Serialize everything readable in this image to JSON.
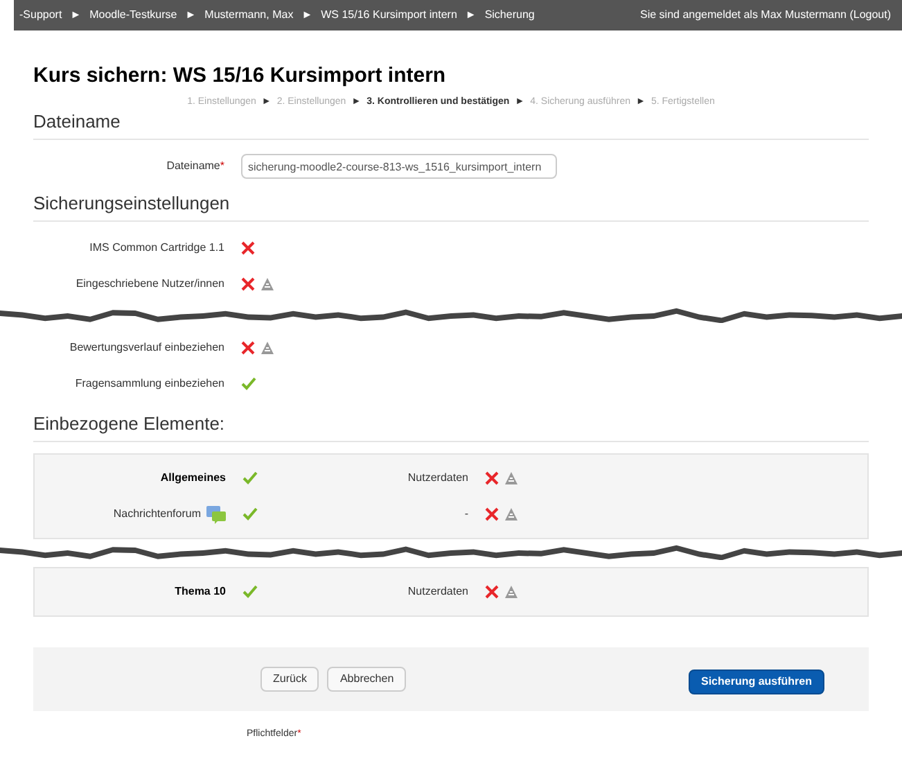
{
  "navbar": {
    "breadcrumbs": [
      "-Support",
      "Moodle-Testkurse",
      "Mustermann, Max",
      "WS 15/16 Kursimport intern",
      "Sicherung"
    ],
    "separator": "►",
    "login": "Sie sind angemeldet als Max Mustermann (Logout)"
  },
  "title": "Kurs sichern: WS 15/16 Kursimport intern",
  "steps": [
    {
      "label": "1. Einstellungen",
      "selected": false
    },
    {
      "label": "2. Einstellungen",
      "selected": false
    },
    {
      "label": "3. Kontrollieren und bestätigen",
      "selected": true
    },
    {
      "label": "4. Sicherung ausführen",
      "selected": false
    },
    {
      "label": "5. Fertigstellen",
      "selected": false
    }
  ],
  "filename_section": {
    "heading": "Dateiname",
    "label": "Dateiname",
    "required_mark": "*",
    "value": "sicherung-moodle2-course-813-ws_1516_kursimport_intern"
  },
  "settings_section": {
    "heading": "Sicherungseinstellungen",
    "items": [
      {
        "label": "IMS Common Cartridge 1.1",
        "included": false,
        "locked": false,
        "cut_below": false
      },
      {
        "label": "Eingeschriebene Nutzer/innen",
        "included": false,
        "locked": true,
        "cut_below": true
      },
      {
        "label": "Bewertungsverlauf einbeziehen",
        "included": false,
        "locked": true,
        "cut_below": false
      },
      {
        "label": "Fragensammlung einbeziehen",
        "included": true,
        "locked": false,
        "cut_below": false
      }
    ]
  },
  "elements_section": {
    "heading": "Einbezogene Elemente:",
    "rows": [
      {
        "kind": "section",
        "label": "Allgemeines",
        "included": true,
        "userdata_label": "Nutzerdaten",
        "userdata_included": false,
        "locked": true,
        "cut_below": false
      },
      {
        "kind": "forum",
        "label": "Nachrichtenforum",
        "included": true,
        "userdata_label": "-",
        "userdata_included": false,
        "locked": true,
        "cut_below": true
      },
      {
        "kind": "section",
        "label": "Thema 10",
        "included": true,
        "userdata_label": "Nutzerdaten",
        "userdata_included": false,
        "locked": true,
        "cut_below": false
      }
    ]
  },
  "buttons": [
    {
      "label": "Zurück",
      "kind": "secondary"
    },
    {
      "label": "Abbrechen",
      "kind": "secondary"
    },
    {
      "label": "Sicherung ausführen",
      "kind": "primary"
    }
  ],
  "required_note": {
    "label": "Pflichtfelder",
    "mark": "*"
  }
}
